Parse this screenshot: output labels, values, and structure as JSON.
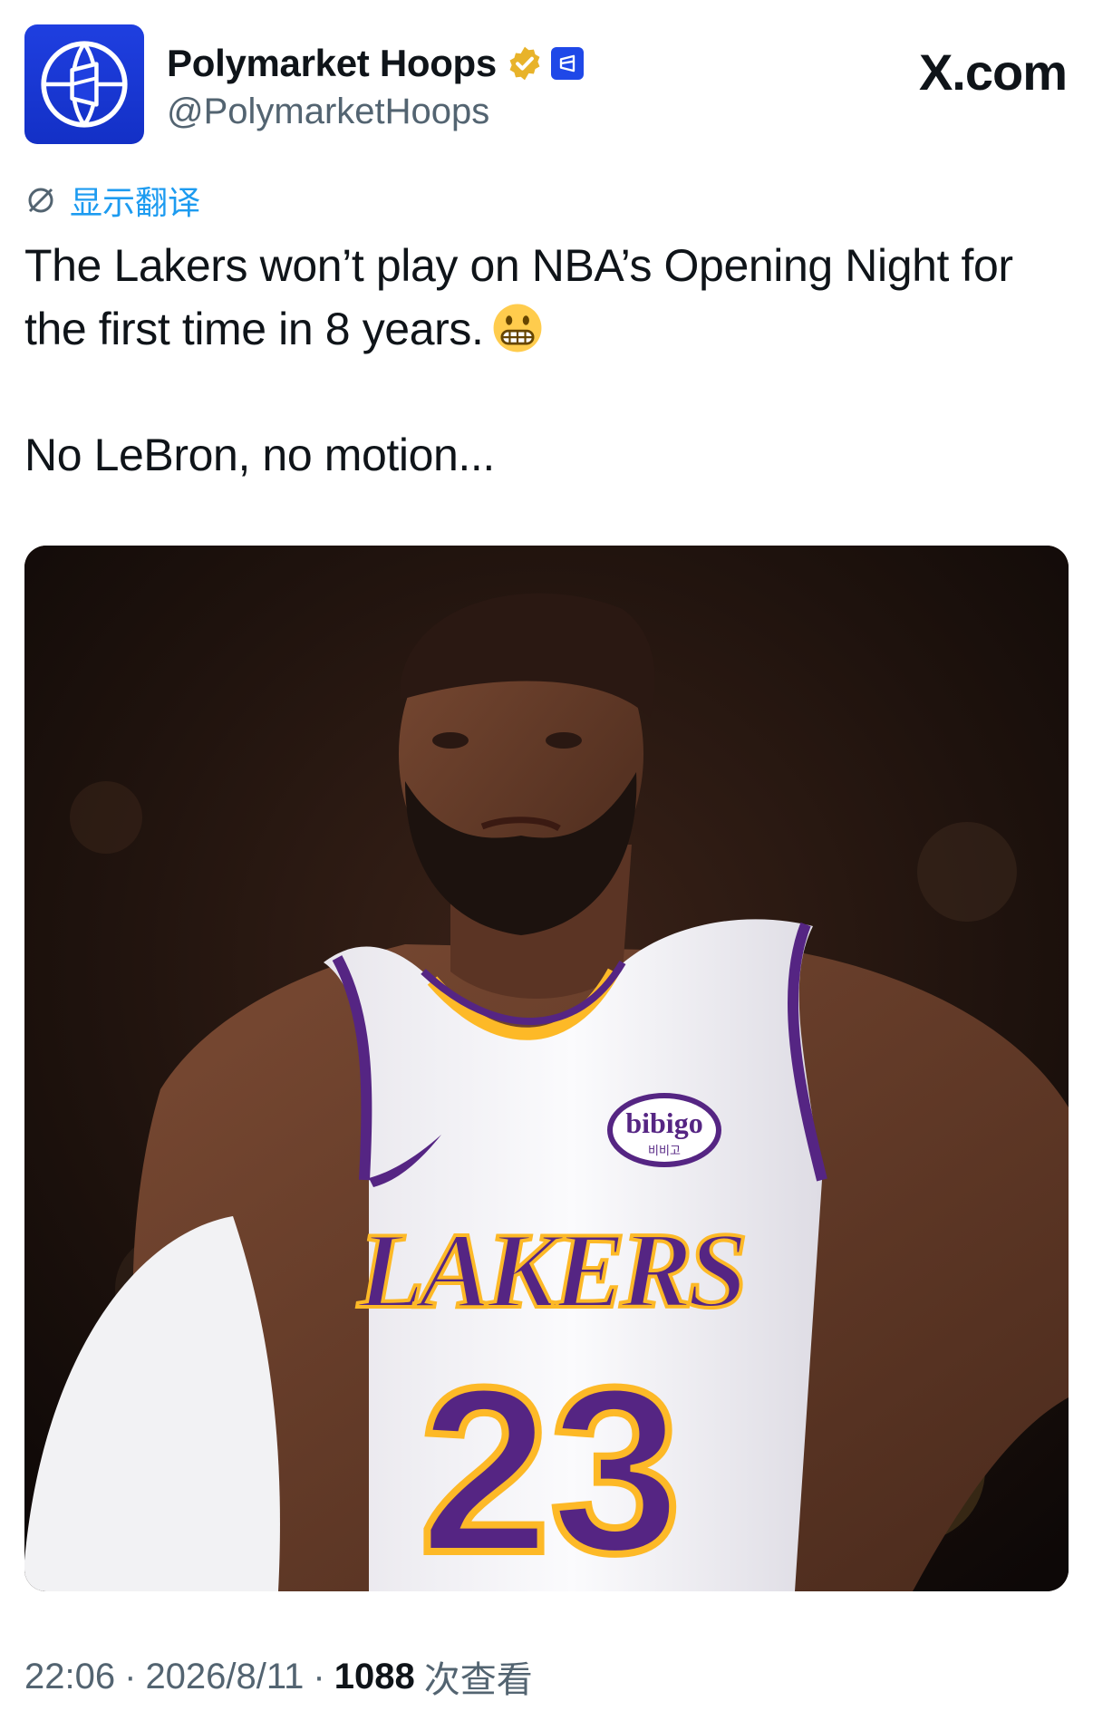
{
  "tweet": {
    "author": {
      "display_name": "Polymarket Hoops",
      "handle": "@PolymarketHoops",
      "avatar_icon": "polymarket-basketball-logo",
      "verified_icon": "gold-verified-badge",
      "affiliate_icon": "polymarket-affiliate-badge"
    },
    "site": "X.com",
    "translate_label": "显示翻译",
    "text_line_1": "The Lakers won’t play on NBA’s Opening Night for",
    "text_line_2": "the first time in 8 years.",
    "text_emoji": "grimacing-face-emoji",
    "text_line_3": "No LeBron, no motion...",
    "media": {
      "jersey_team": "LAKERS",
      "jersey_number": "23",
      "sponsor_patch": "bibigo",
      "sponsor_patch_sub": "비비고"
    },
    "meta": {
      "time": "22:06",
      "separator": "·",
      "date": "2026/8/11",
      "views_count": "1088",
      "views_label": "次查看"
    }
  },
  "colors": {
    "brand_blue": "#1f48e8",
    "verified_gold": "#e8b32a",
    "link_blue": "#1d9bf0",
    "lakers_purple": "#552583",
    "lakers_gold": "#fdb927"
  }
}
